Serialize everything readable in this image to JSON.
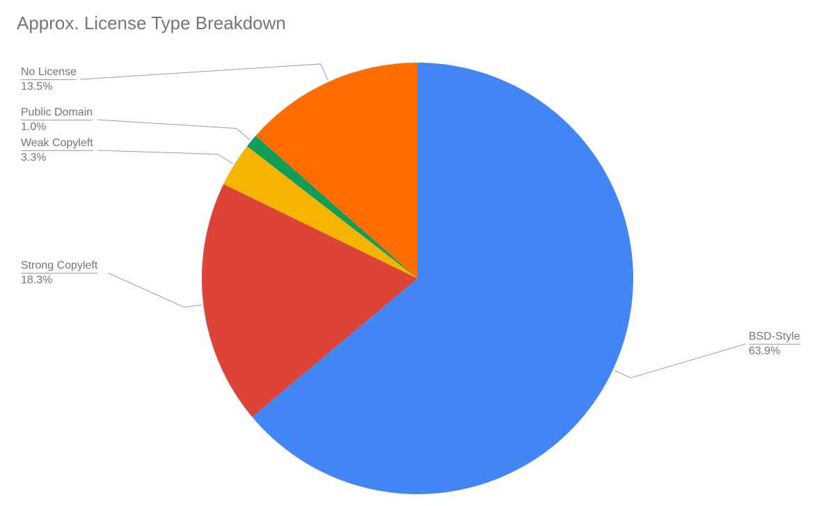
{
  "chart_data": {
    "type": "pie",
    "title": "Approx. License Type Breakdown",
    "series": [
      {
        "name": "BSD-Style",
        "value": 63.9,
        "color": "#4285F4"
      },
      {
        "name": "Strong Copyleft",
        "value": 18.3,
        "color": "#DB4437"
      },
      {
        "name": "Weak Copyleft",
        "value": 3.3,
        "color": "#F4B400"
      },
      {
        "name": "Public Domain",
        "value": 1.0,
        "color": "#0F9D58"
      },
      {
        "name": "No License",
        "value": 13.5,
        "color": "#FF6D00"
      }
    ],
    "value_suffix": "%"
  },
  "labels": {
    "bsd_name": "BSD-Style",
    "bsd_value": "63.9%",
    "strong_name": "Strong Copyleft",
    "strong_value": "18.3%",
    "weak_name": "Weak Copyleft",
    "weak_value": "3.3%",
    "public_name": "Public Domain",
    "public_value": "1.0%",
    "nolic_name": "No License",
    "nolic_value": "13.5%"
  }
}
